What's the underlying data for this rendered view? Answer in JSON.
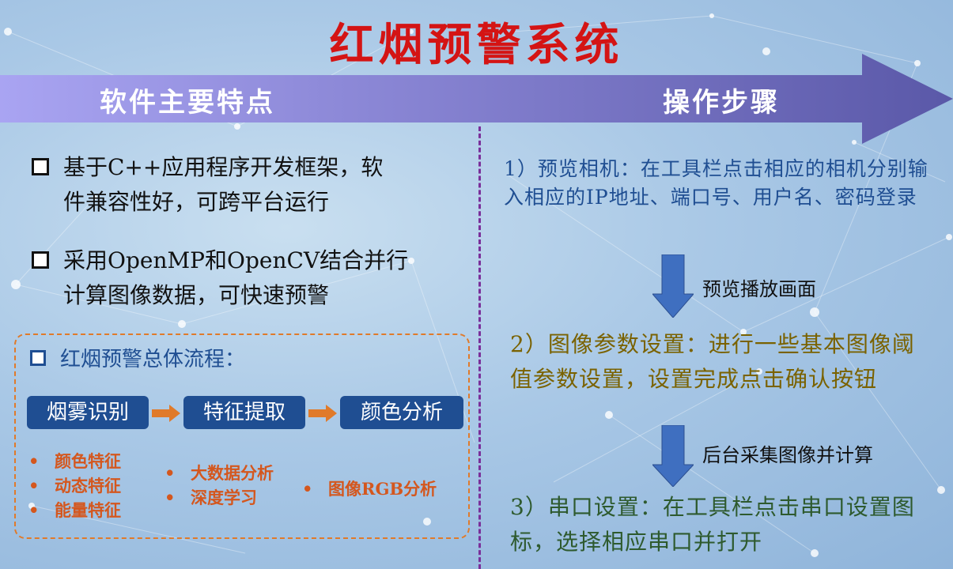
{
  "title": "红烟预警系统",
  "banner": {
    "left_label": "软件主要特点",
    "right_label": "操作步骤"
  },
  "features": [
    {
      "line1": "基于C++应用程序开发框架，软",
      "line2": "件兼容性好，可跨平台运行"
    },
    {
      "line1": "采用OpenMP和OpenCV结合并行",
      "line2": "计算图像数据，可快速预警"
    }
  ],
  "flow": {
    "heading": "红烟预警总体流程：",
    "stages": [
      "烟雾识别",
      "特征提取",
      "颜色分析"
    ],
    "col1": [
      "颜色特征",
      "动态特征",
      "能量特征"
    ],
    "col2": [
      "大数据分析",
      "深度学习"
    ],
    "col3": [
      "图像RGB分析"
    ]
  },
  "steps": {
    "step1": "1）预览相机：在工具栏点击相应的相机分别输入相应的IP地址、端口号、用户名、密码登录",
    "note1": "预览播放画面",
    "step2": "2）图像参数设置：进行一些基本图像阈值参数设置，设置完成点击确认按钮",
    "note2": "后台采集图像并计算",
    "step3": "3）串口设置：在工具栏点击串口设置图标，选择相应串口并打开"
  },
  "colors": {
    "title": "#d41414",
    "banner_start": "#a9a4f2",
    "banner_end": "#5a58a8",
    "flow_box": "#1f4e92",
    "flow_arrow": "#e07a2a",
    "down_arrow": "#3f6fc0"
  }
}
